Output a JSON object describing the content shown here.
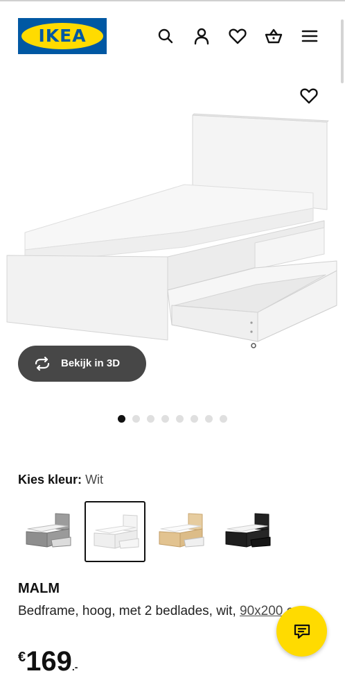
{
  "header": {
    "logo_text": "IKEA",
    "brand_colors": {
      "blue": "#0058a3",
      "yellow": "#ffdb00"
    },
    "icons": [
      "search-icon",
      "user-icon",
      "heart-icon",
      "basket-icon",
      "menu-icon"
    ]
  },
  "gallery": {
    "favorite_icon": "heart-icon",
    "view_3d_label": "Bekijk in 3D",
    "view_3d_icon": "rotate-3d-icon",
    "slide_count": 8,
    "active_slide": 1
  },
  "color_picker": {
    "label": "Kies kleur:",
    "selected_value": "Wit",
    "options": [
      {
        "name": "grey",
        "color": "#8a8a8a",
        "selected": false
      },
      {
        "name": "white",
        "color": "#ffffff",
        "selected": true
      },
      {
        "name": "oak",
        "color": "#e2c79a",
        "selected": false
      },
      {
        "name": "black",
        "color": "#1e1e1e",
        "selected": false
      }
    ]
  },
  "product": {
    "name": "MALM",
    "description": "Bedframe, hoog, met 2 bedlades, wit,",
    "size": "90x200 cm",
    "price_currency": "€",
    "price_integer": "169",
    "price_decimal": ".-"
  },
  "chat": {
    "icon": "chat-icon",
    "accent": "#ffdb00"
  }
}
